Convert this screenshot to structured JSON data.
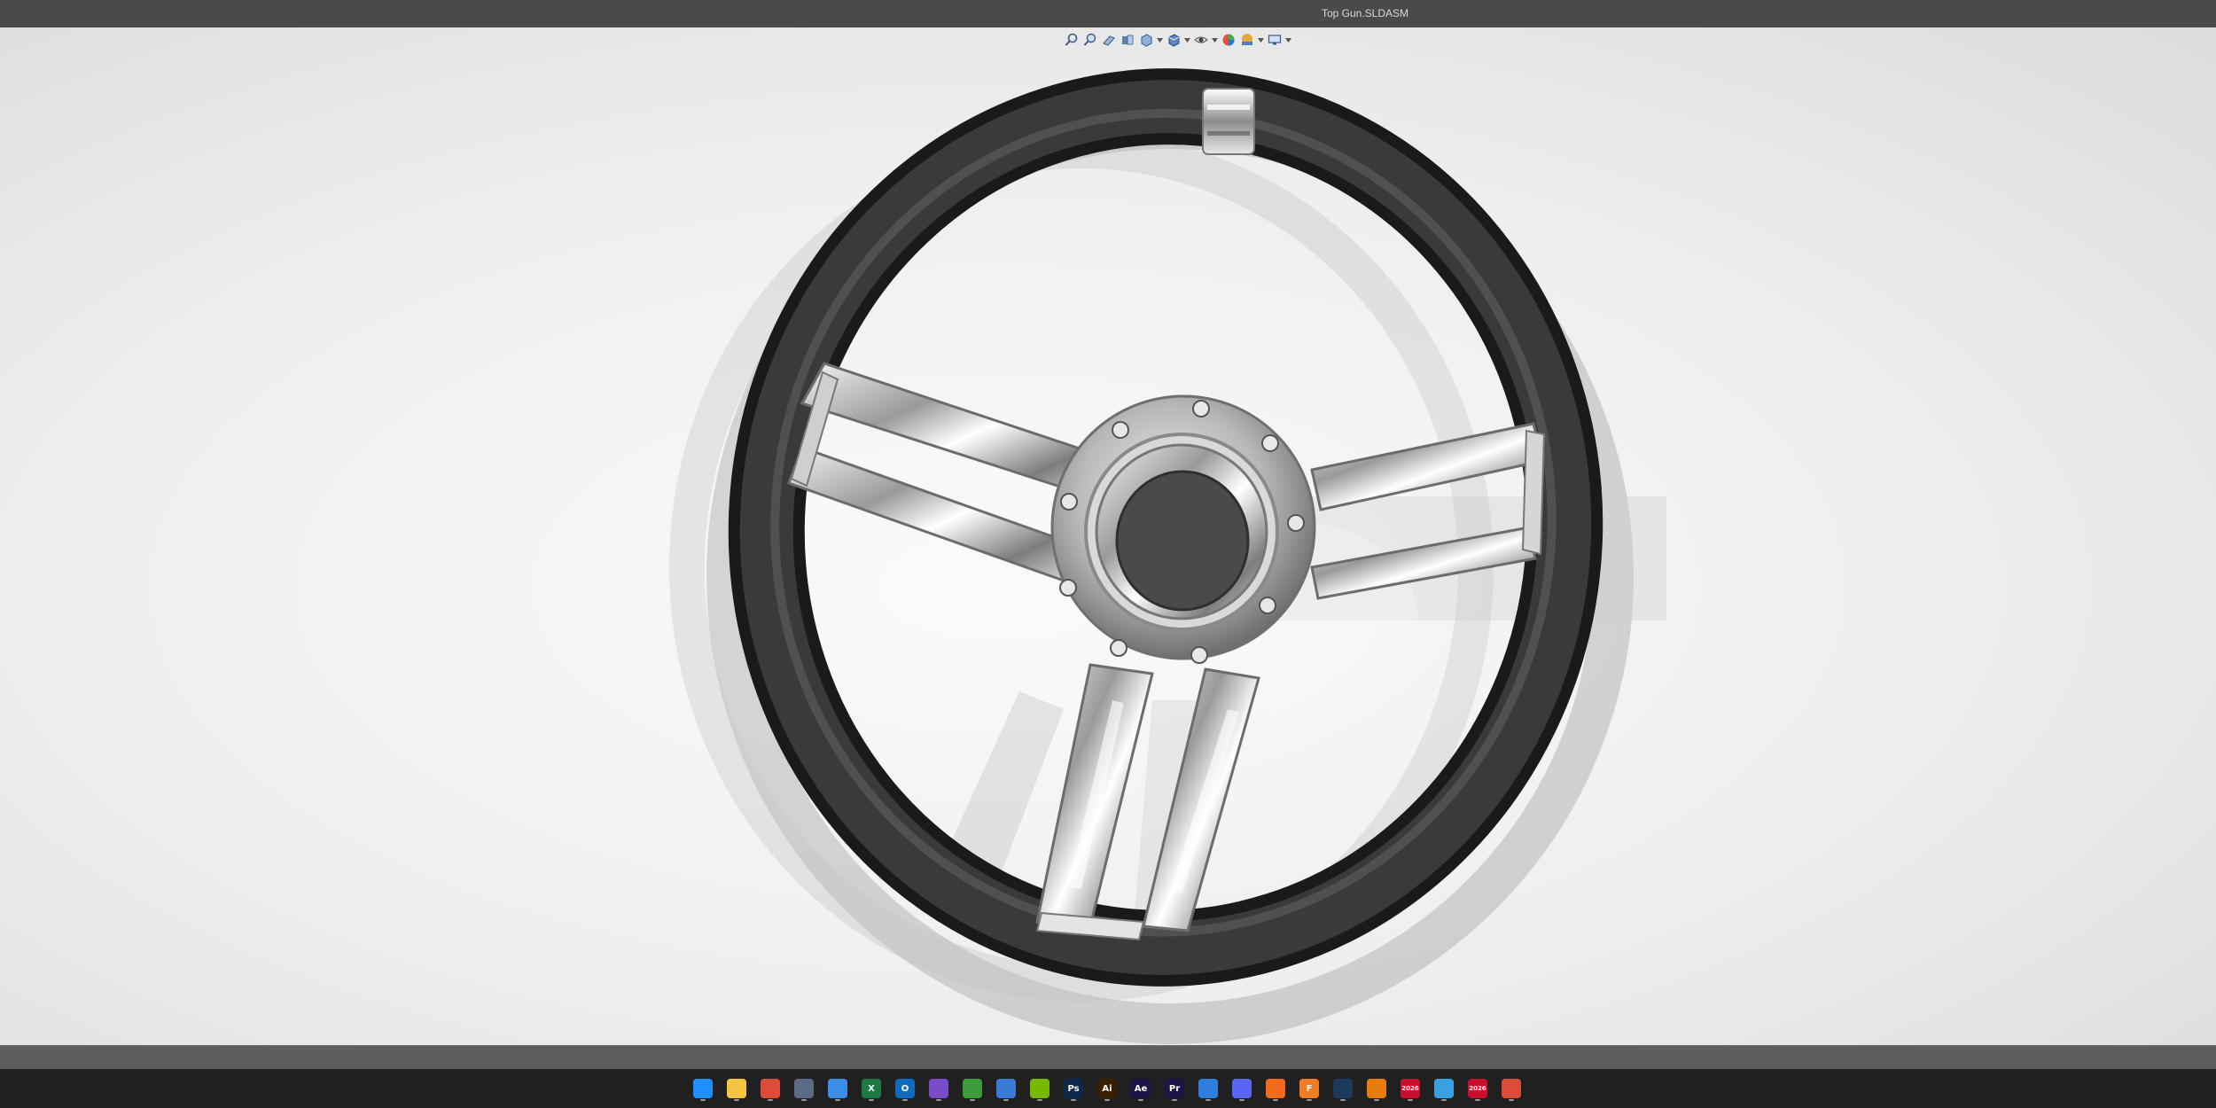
{
  "window": {
    "title": "Top Gun.SLDASM"
  },
  "toolbar": {
    "items": [
      {
        "name": "zoom-to-fit-icon",
        "has_dropdown": false
      },
      {
        "name": "zoom-to-area-icon",
        "has_dropdown": false
      },
      {
        "name": "previous-view-icon",
        "has_dropdown": false
      },
      {
        "name": "section-view-icon",
        "has_dropdown": false
      },
      {
        "name": "view-orientation-icon",
        "has_dropdown": true
      },
      {
        "name": "display-style-icon",
        "has_dropdown": true
      },
      {
        "name": "hide-show-items-icon",
        "has_dropdown": true
      },
      {
        "name": "edit-appearance-icon",
        "has_dropdown": false
      },
      {
        "name": "apply-scene-icon",
        "has_dropdown": true
      },
      {
        "name": "view-settings-icon",
        "has_dropdown": true
      }
    ]
  },
  "taskbar": {
    "apps": [
      {
        "name": "windows-start-icon",
        "label": "",
        "color": "#1f8fff"
      },
      {
        "name": "file-explorer-icon",
        "label": "",
        "color": "#f5c542"
      },
      {
        "name": "chrome-icon",
        "label": "",
        "color": "#dd4b39"
      },
      {
        "name": "calculator-icon",
        "label": "",
        "color": "#5a6b86"
      },
      {
        "name": "ms-store-icon",
        "label": "",
        "color": "#3a8ee6"
      },
      {
        "name": "excel-icon",
        "label": "X",
        "color": "#1d7a45"
      },
      {
        "name": "outlook-icon",
        "label": "O",
        "color": "#0f6cbd"
      },
      {
        "name": "photos-icon",
        "label": "",
        "color": "#7a4cc9"
      },
      {
        "name": "xbox-icon",
        "label": "",
        "color": "#3c9c3c"
      },
      {
        "name": "notepad-icon",
        "label": "",
        "color": "#3a7bd5"
      },
      {
        "name": "nvidia-icon",
        "label": "",
        "color": "#76b900"
      },
      {
        "name": "photoshop-icon",
        "label": "Ps",
        "color": "#0b2a4a"
      },
      {
        "name": "illustrator-icon",
        "label": "Ai",
        "color": "#3a1e00"
      },
      {
        "name": "after-effects-icon",
        "label": "Ae",
        "color": "#1b1548"
      },
      {
        "name": "premiere-icon",
        "label": "Pr",
        "color": "#1b1548"
      },
      {
        "name": "mail-icon",
        "label": "",
        "color": "#2f7fe0"
      },
      {
        "name": "discord-icon",
        "label": "",
        "color": "#5865f2"
      },
      {
        "name": "origin-icon",
        "label": "",
        "color": "#f26a1b"
      },
      {
        "name": "fusion-icon",
        "label": "F",
        "color": "#f07d21"
      },
      {
        "name": "steam-icon",
        "label": "",
        "color": "#1b3a5c"
      },
      {
        "name": "blender-icon",
        "label": "",
        "color": "#e87d0d"
      },
      {
        "name": "solidworks-2026-a-icon",
        "label": "2026",
        "color": "#c8102e"
      },
      {
        "name": "box-app-icon",
        "label": "",
        "color": "#3aa0e0"
      },
      {
        "name": "solidworks-2026-b-icon",
        "label": "2026",
        "color": "#c8102e"
      },
      {
        "name": "chrome-beta-icon",
        "label": "",
        "color": "#dd4b39"
      }
    ]
  }
}
